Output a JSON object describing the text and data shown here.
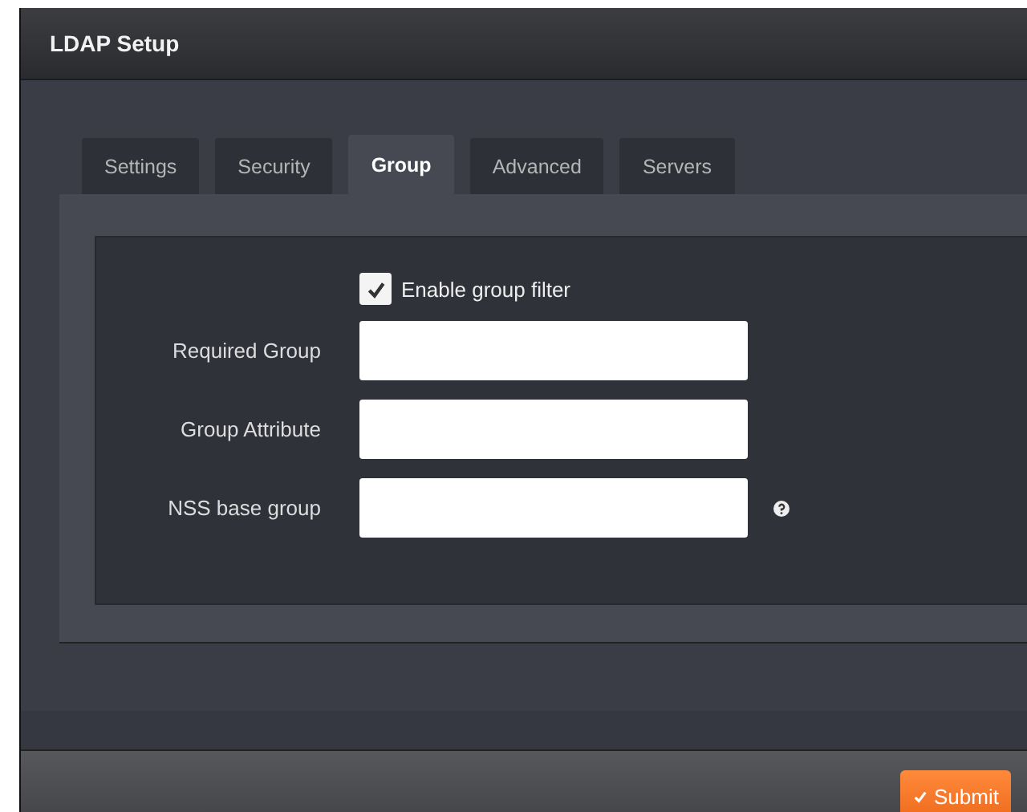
{
  "window": {
    "title": "LDAP Setup"
  },
  "tabs": [
    {
      "label": "Settings",
      "selected": false
    },
    {
      "label": "Security",
      "selected": false
    },
    {
      "label": "Group",
      "selected": true
    },
    {
      "label": "Advanced",
      "selected": false
    },
    {
      "label": "Servers",
      "selected": false
    }
  ],
  "enable_filter": {
    "label": "Enable group filter",
    "checked": true
  },
  "fields": [
    {
      "label": "Required Group",
      "help": false
    },
    {
      "label": "Group Attribute",
      "help": false
    },
    {
      "label": "NSS base group",
      "help": true
    }
  ],
  "footer": {
    "submit": "Submit"
  }
}
